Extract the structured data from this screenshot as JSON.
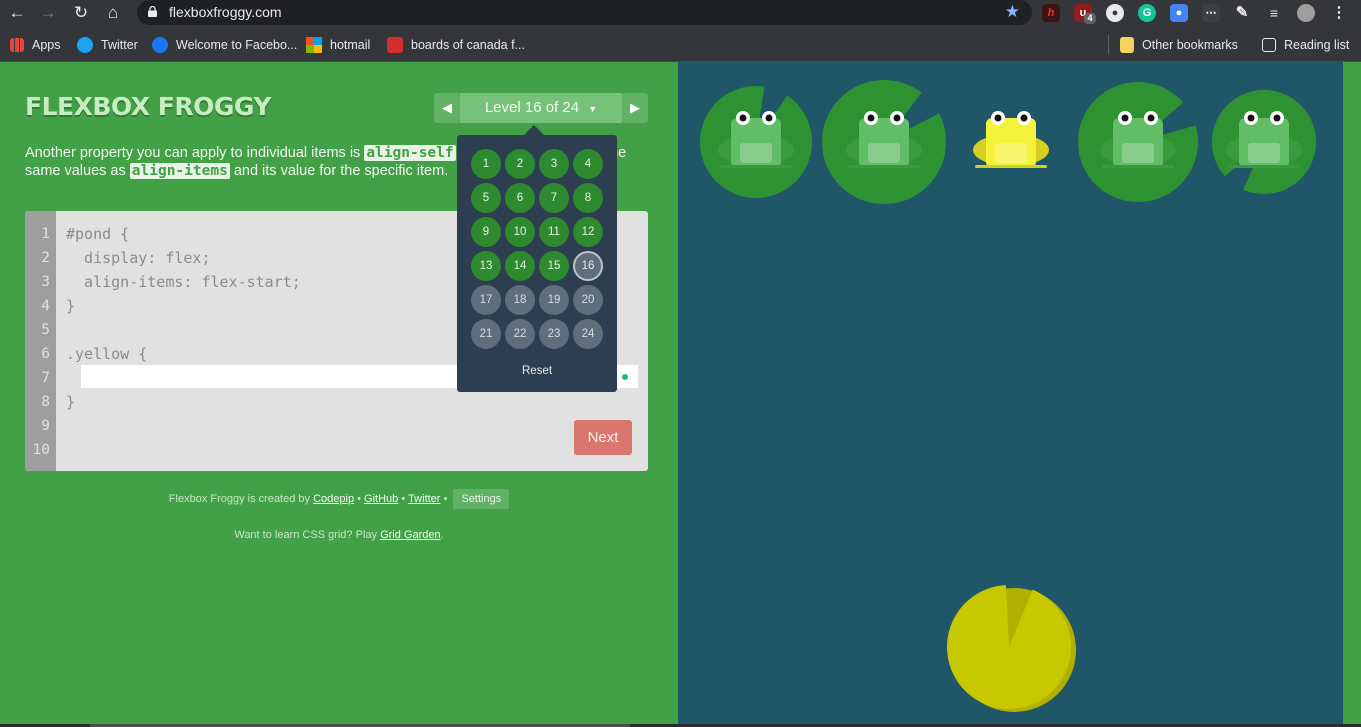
{
  "browser": {
    "url": "flexboxfroggy.com",
    "bookmarks": [
      "Apps",
      "Twitter",
      "Welcome to Facebo...",
      "hotmail",
      "boards of canada f...",
      "Other bookmarks",
      "Reading list"
    ],
    "extension_badge": "4"
  },
  "game": {
    "title": "FLEXBOX FROGGY",
    "level_label": "Level 16 of 24",
    "instructions": {
      "part1": "Another property you can apply to individual items is ",
      "code1": "align-self",
      "part2": ". This property accepts the same values as ",
      "code2": "align-items",
      "part3": " and its value for the specific item."
    },
    "code_lines": [
      "#pond {",
      "  display: flex;",
      "  align-items: flex-start;",
      "}",
      "",
      ".yellow {",
      "",
      "}",
      "",
      ""
    ],
    "line_numbers": [
      "1",
      "2",
      "3",
      "4",
      "5",
      "6",
      "7",
      "8",
      "9",
      "10"
    ],
    "input_value": "",
    "next_label": "Next",
    "credits": {
      "prefix": "Flexbox Froggy is created by ",
      "codepip": "Codepip",
      "github": "GitHub",
      "twitter": "Twitter",
      "sep": " • ",
      "settings": "Settings"
    },
    "learn": {
      "prefix": "Want to learn CSS grid? Play ",
      "link": "Grid Garden",
      "suffix": "."
    }
  },
  "level_menu": {
    "levels": [
      "1",
      "2",
      "3",
      "4",
      "5",
      "6",
      "7",
      "8",
      "9",
      "10",
      "11",
      "12",
      "13",
      "14",
      "15",
      "16",
      "17",
      "18",
      "19",
      "20",
      "21",
      "22",
      "23",
      "24"
    ],
    "completed_through": 15,
    "current": 16,
    "reset_label": "Reset"
  },
  "pond": {
    "frogs": [
      "green",
      "green",
      "yellow",
      "green",
      "green"
    ],
    "lilypads": [
      "green",
      "green",
      "yellow",
      "green",
      "green"
    ]
  },
  "colors": {
    "page_green": "#42a047",
    "pond_blue": "#1f5768",
    "frog_green": "#61bd66",
    "frog_yellow": "#f5f23c",
    "pad_green": "#2e9232",
    "pad_yellow": "#c8c800",
    "next_button": "#d9776f",
    "menu_bg": "#2c3e50"
  }
}
